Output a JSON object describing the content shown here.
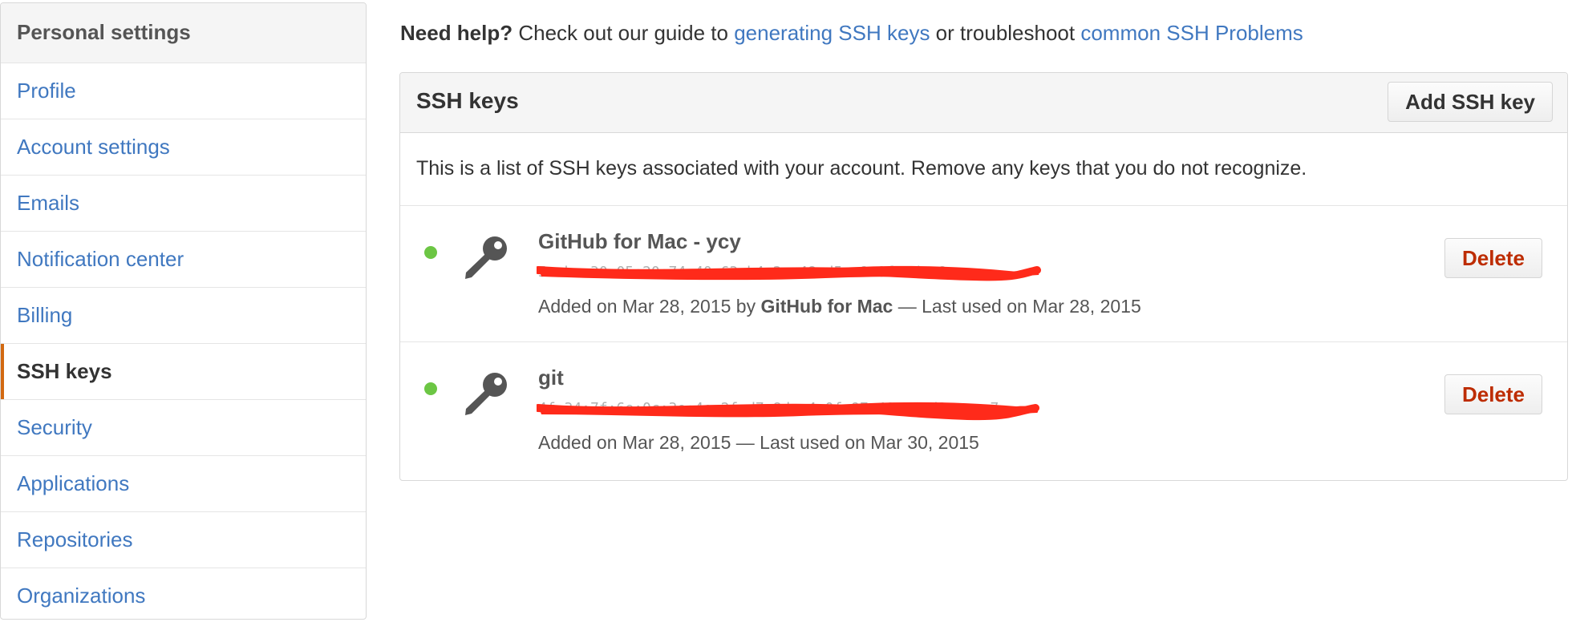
{
  "sidebar": {
    "header": "Personal settings",
    "items": [
      {
        "label": "Profile"
      },
      {
        "label": "Account settings"
      },
      {
        "label": "Emails"
      },
      {
        "label": "Notification center"
      },
      {
        "label": "Billing"
      },
      {
        "label": "SSH keys",
        "selected": true
      },
      {
        "label": "Security"
      },
      {
        "label": "Applications"
      },
      {
        "label": "Repositories"
      },
      {
        "label": "Organizations"
      }
    ]
  },
  "help": {
    "prefix": "Need help?",
    "text1": " Check out our guide to ",
    "link1": "generating SSH keys",
    "text2": " or troubleshoot ",
    "link2": "common SSH Problems"
  },
  "panel": {
    "title": "SSH keys",
    "add_button": "Add SSH key",
    "description": "This is a list of SSH keys associated with your account. Remove any keys that you do not recognize."
  },
  "keys": [
    {
      "title": "GitHub for Mac - ycy",
      "fingerprint": "5c:be:30:05:20:74:40:63:b4:2e:48:d5:a9:0f:ad:c8",
      "added_prefix": "Added on Mar 28, 2015 by ",
      "added_by": "GitHub for Mac",
      "last_used": " — Last used on Mar 28, 2015",
      "delete_label": "Delete"
    },
    {
      "title": "git",
      "fingerprint": "4f:34:7f:6e:0c:3e:4e:2f:d7:8d:e4:0f:97:40:a8:d3:ae:c7",
      "added_prefix": "Added on Mar 28, 2015",
      "added_by": "",
      "last_used": " — Last used on Mar 30, 2015",
      "delete_label": "Delete"
    }
  ],
  "colors": {
    "link": "#4078c0",
    "selected_marker": "#d26911",
    "status_active": "#6cc644",
    "delete_text": "#bd2c00",
    "redaction": "#ff2a1a"
  },
  "icons": [
    "key-icon",
    "status-dot"
  ]
}
